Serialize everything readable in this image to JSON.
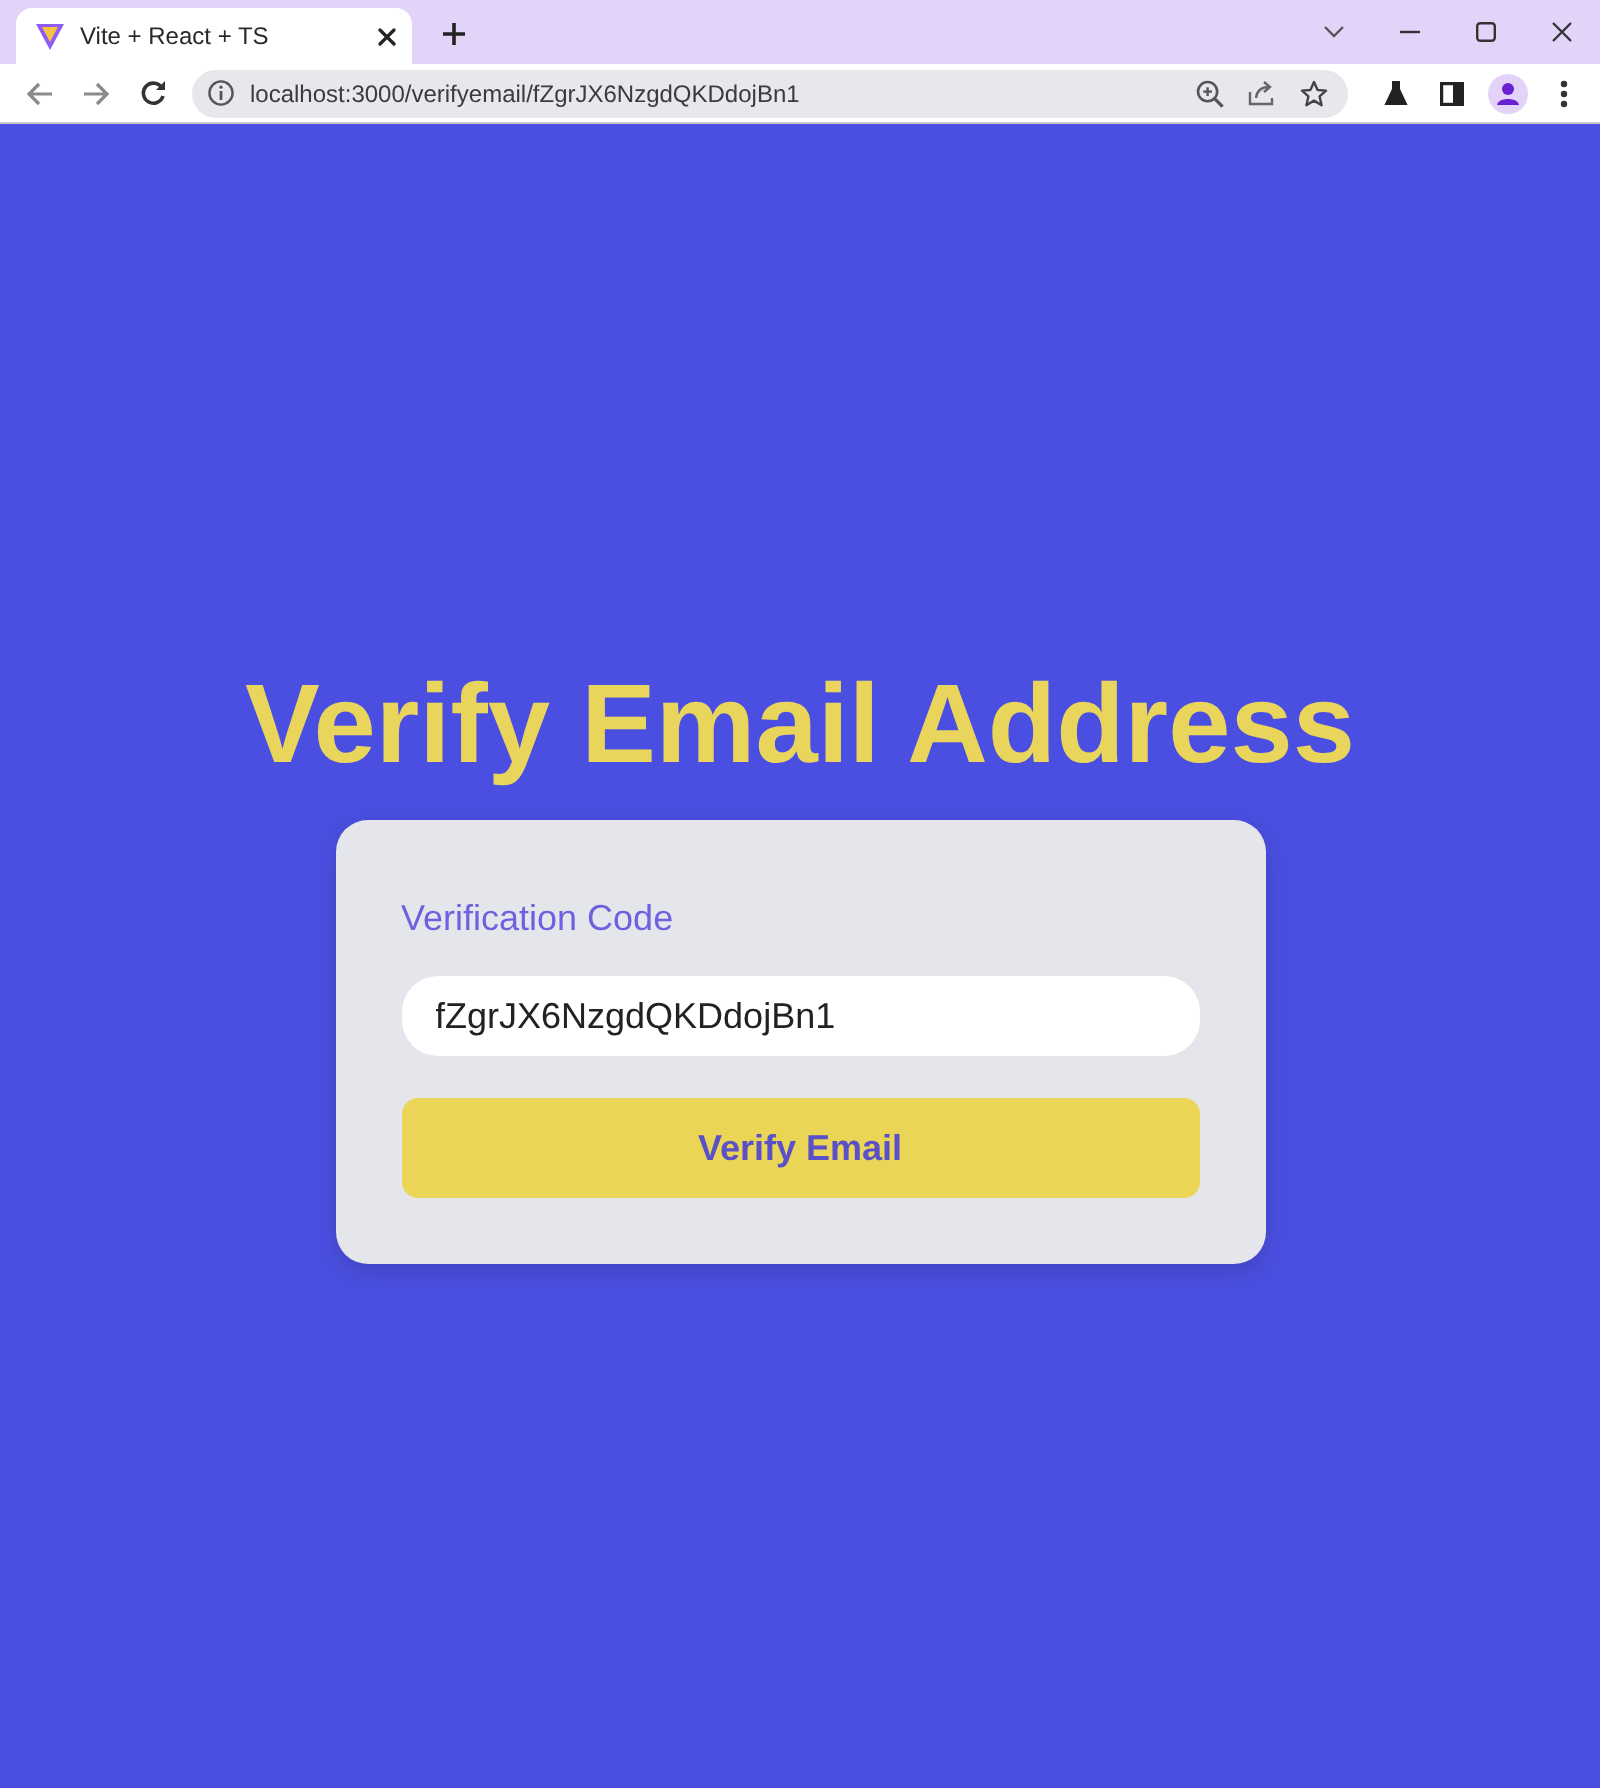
{
  "browser": {
    "tabs": [
      {
        "title": "Vite + React + TS",
        "selected": true
      }
    ],
    "address": "localhost:3000/verifyemail/fZgrJX6NzgdQKDdojBn1"
  },
  "page": {
    "heading": "Verify Email Address",
    "form": {
      "label": "Verification Code",
      "value": "fZgrJX6NzgdQKDdojBn1",
      "button": "Verify Email"
    }
  }
}
